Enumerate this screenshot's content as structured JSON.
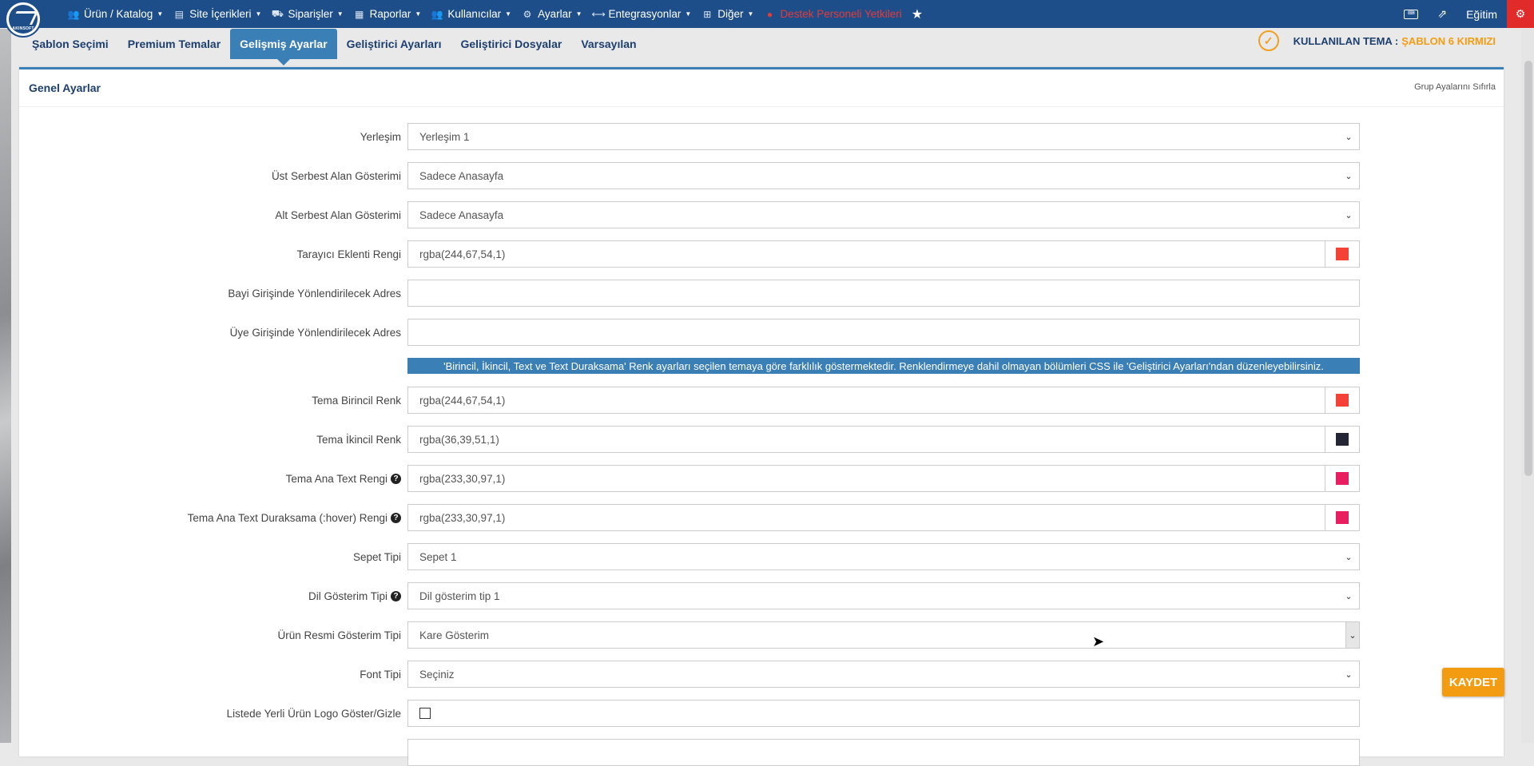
{
  "nav": {
    "items": [
      {
        "icon": "users-icon",
        "glyph": "👥",
        "label": "Ürün / Katalog",
        "caret": true
      },
      {
        "icon": "content-icon",
        "glyph": "▤",
        "label": "Site İçerikleri",
        "caret": true
      },
      {
        "icon": "truck-icon",
        "glyph": "⛟",
        "label": "Siparişler",
        "caret": true
      },
      {
        "icon": "report-icon",
        "glyph": "▦",
        "label": "Raporlar",
        "caret": true
      },
      {
        "icon": "users-group-icon",
        "glyph": "👥",
        "label": "Kullanıcılar",
        "caret": true
      },
      {
        "icon": "settings-icon",
        "glyph": "⚙",
        "label": "Ayarlar",
        "caret": true
      },
      {
        "icon": "integration-icon",
        "glyph": "⟷",
        "label": "Entegrasyonlar",
        "caret": true
      },
      {
        "icon": "other-icon",
        "glyph": "⊞",
        "label": "Diğer",
        "caret": true
      },
      {
        "icon": "support-icon",
        "glyph": "●",
        "label": "Destek Personeli Yetkileri",
        "caret": false
      }
    ],
    "right_label": "Eğitim",
    "logo_text": "AKINSOFT"
  },
  "tabs": [
    "Şablon Seçimi",
    "Premium Temalar",
    "Gelişmiş Ayarlar",
    "Geliştirici Ayarları",
    "Geliştirici Dosyalar",
    "Varsayılan"
  ],
  "theme": {
    "label": "KULLANILAN TEMA :",
    "value": "ŞABLON 6 KIRMIZI"
  },
  "panel": {
    "title": "Genel Ayarlar",
    "reset": "Grup Ayalarını Sıfırla"
  },
  "rows": {
    "r1": {
      "label": "Yerleşim",
      "value": "Yerleşim 1"
    },
    "r2": {
      "label": "Üst Serbest Alan Gösterimi",
      "value": "Sadece Anasayfa"
    },
    "r3": {
      "label": "Alt Serbest Alan Gösterimi",
      "value": "Sadece Anasayfa"
    },
    "r4": {
      "label": "Tarayıcı Eklenti Rengi",
      "value": "rgba(244,67,54,1)",
      "swatch": "#f44336"
    },
    "r5": {
      "label": "Bayi Girişinde Yönlendirilecek Adres",
      "value": ""
    },
    "r6": {
      "label": "Üye Girişinde Yönlendirilecek Adres",
      "value": ""
    },
    "info": "'Birincil, İkincil, Text ve Text Duraksama' Renk ayarları seçilen temaya göre farklılık göstermektedir. Renklendirmeye dahil olmayan bölümleri CSS ile 'Geliştirici Ayarları'ndan düzenleyebilirsiniz.",
    "r7": {
      "label": "Tema Birincil Renk",
      "value": "rgba(244,67,54,1)",
      "swatch": "#f44336"
    },
    "r8": {
      "label": "Tema İkincil Renk",
      "value": "rgba(36,39,51,1)",
      "swatch": "#242733"
    },
    "r9": {
      "label": "Tema Ana Text Rengi",
      "value": "rgba(233,30,97,1)",
      "swatch": "#e91e61"
    },
    "r10": {
      "label": "Tema Ana Text Duraksama (:hover) Rengi",
      "value": "rgba(233,30,97,1)",
      "swatch": "#e91e61"
    },
    "r11": {
      "label": "Sepet Tipi",
      "value": "Sepet 1"
    },
    "r12": {
      "label": "Dil Gösterim Tipi",
      "value": "Dil gösterim tip 1"
    },
    "r13": {
      "label": "Ürün Resmi Gösterim Tipi",
      "value": "Kare Gösterim"
    },
    "r14": {
      "label": "Font Tipi",
      "value": "Seçiniz"
    },
    "r15": {
      "label": "Listede Yerli Ürün Logo Göster/Gizle",
      "checked": false
    }
  },
  "save_label": "KAYDET"
}
